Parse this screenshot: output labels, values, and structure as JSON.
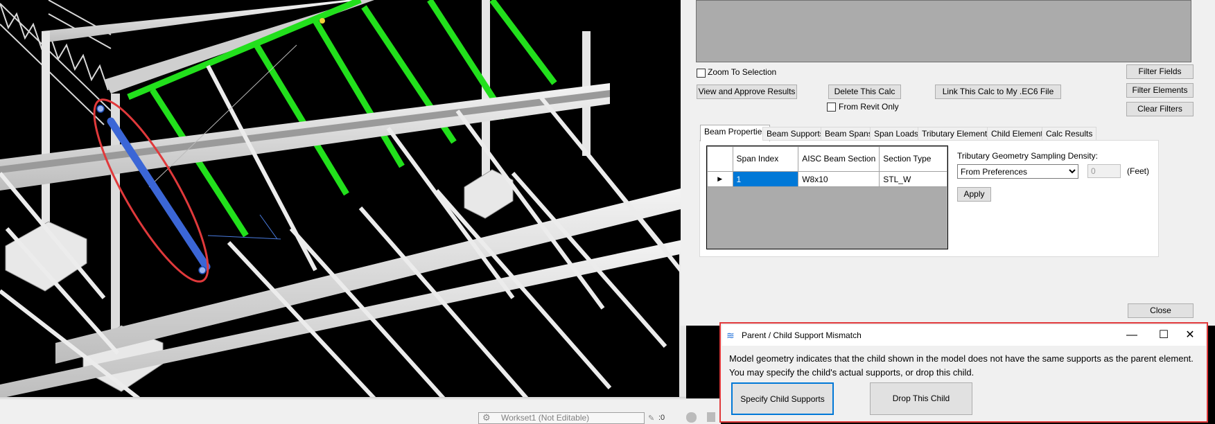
{
  "panel": {
    "zoom_to_selection": "Zoom To Selection",
    "view_approve": "View and Approve Results",
    "delete_calc": "Delete This Calc",
    "link_calc": "Link This Calc to My .EC6 File",
    "from_revit_only": "From Revit Only",
    "filter_fields": "Filter Fields",
    "filter_elements": "Filter Elements",
    "clear_filters": "Clear Filters",
    "close": "Close",
    "tabs": [
      "Beam Properties",
      "Beam Supports",
      "Beam Spans",
      "Span Loads",
      "Tributary Elements",
      "Child Elements",
      "Calc Results"
    ],
    "grid": {
      "headers": [
        "Span Index",
        "AISC Beam Section",
        "Section Type"
      ],
      "rows": [
        {
          "span_index": "1",
          "section": "W8x10",
          "type": "STL_W"
        }
      ]
    },
    "sampling_label": "Tributary Geometry Sampling Density:",
    "sampling_option": "From Preferences",
    "sampling_value": "0",
    "sampling_unit": "(Feet)",
    "apply": "Apply"
  },
  "dialog": {
    "title": "Parent / Child Support Mismatch",
    "message_line1": "Model geometry indicates that the child shown in the model does not have the same supports as the parent element.",
    "message_line2": "You may specify the child's actual supports, or drop this child.",
    "specify_button": "Specify Child Supports",
    "drop_button": "Drop This Child",
    "minimize": "—",
    "maximize": "☐",
    "close": "✕"
  },
  "statusbar": {
    "workset": "Workset1 (Not Editable)",
    "counter": ":0",
    "view_icons": [
      "scale-icon",
      "detail-level-icon",
      "visual-style-icon",
      "sun-path-icon",
      "shadows-icon",
      "render-icon",
      "crop-icon",
      "show-crop-icon",
      "temporary-hide-icon",
      "reveal-hidden-icon",
      "worksharing-icon",
      "constraints-icon",
      "collapse-icon"
    ]
  },
  "colors": {
    "highlight_green": "#22e01c",
    "selected_beam": "#3b66d6",
    "selection_ellipse": "#e0393b",
    "structure": "#e6e6e6",
    "dialog_border": "#e0393b"
  }
}
